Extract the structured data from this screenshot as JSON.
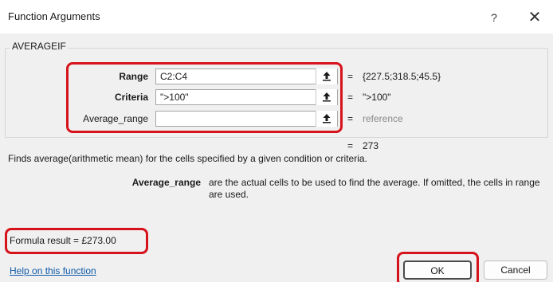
{
  "window": {
    "title": "Function Arguments",
    "help_label": "?",
    "close_label": "✕"
  },
  "function_name": "AVERAGEIF",
  "arguments": [
    {
      "label": "Range",
      "input": "C2:C4",
      "equals": "=",
      "value": "{227.5;318.5;45.5}"
    },
    {
      "label": "Criteria",
      "input": "\">100\"",
      "equals": "=",
      "value": "\">100\""
    },
    {
      "label": "Average_range",
      "input": "",
      "equals": "=",
      "value": "reference"
    }
  ],
  "result": {
    "equals": "=",
    "value": "273"
  },
  "description": "Finds average(arithmetic mean) for the cells specified by a given condition or criteria.",
  "param_help": {
    "name": "Average_range",
    "text": "are the actual cells to be used to find the average. If omitted, the cells in range are used."
  },
  "formula_result": "Formula result =   £273.00",
  "help_link": "Help on this function",
  "buttons": {
    "ok": "OK",
    "cancel": "Cancel"
  },
  "colors": {
    "highlight": "#d6131b",
    "link": "#0f5aa8"
  }
}
